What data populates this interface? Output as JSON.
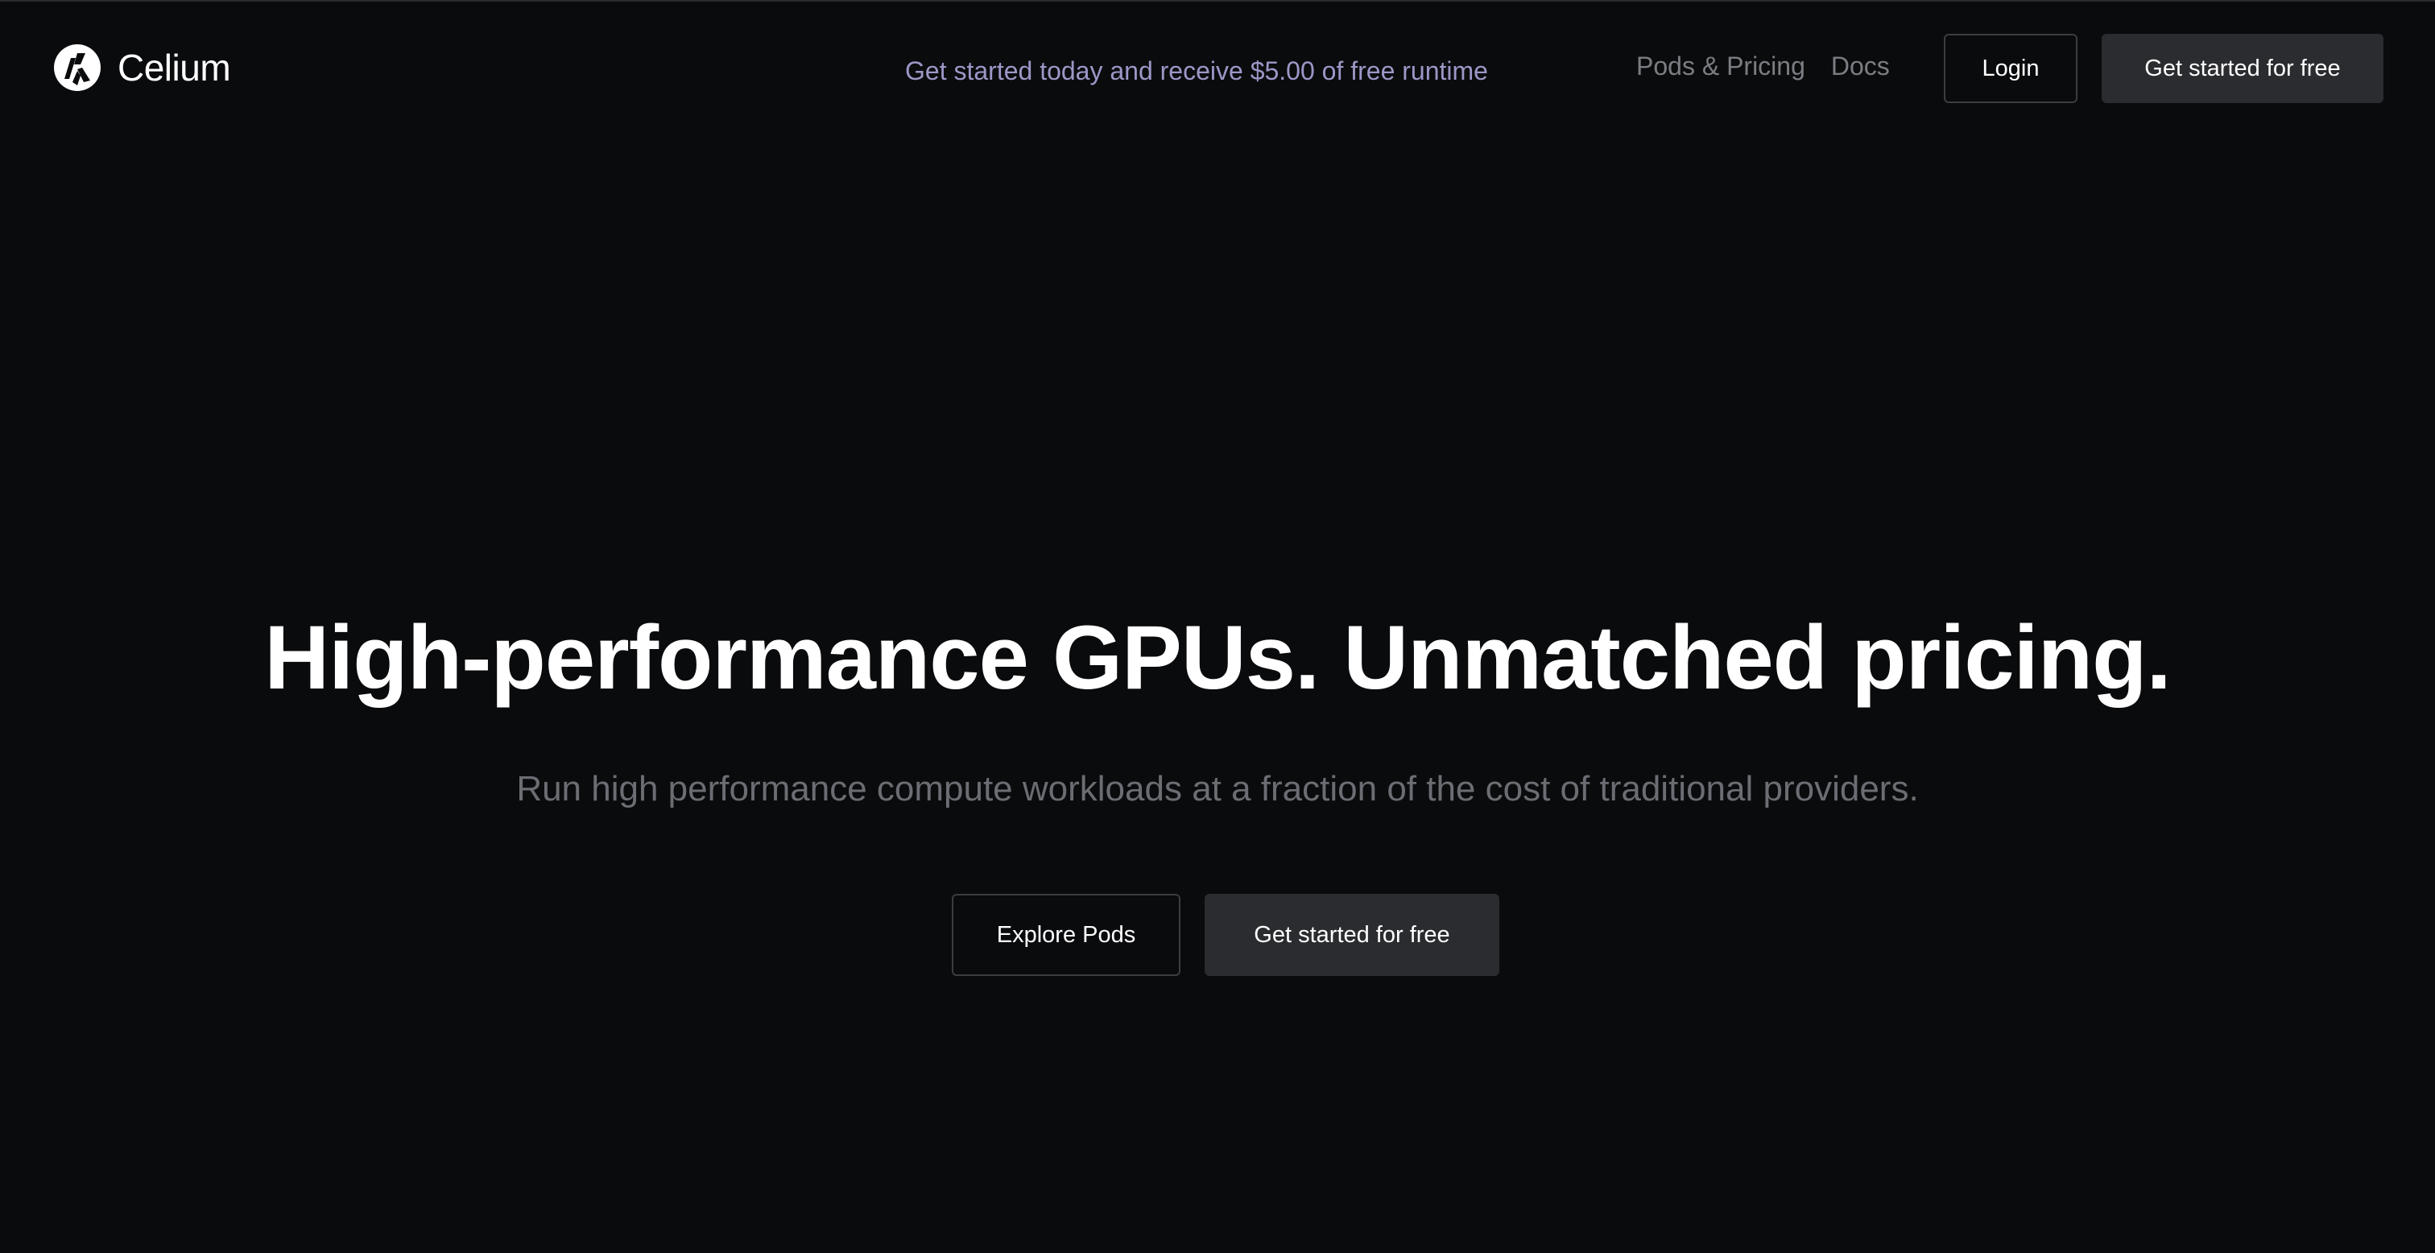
{
  "brand": {
    "name": "Celium",
    "logo_icon": "celium-logo-icon"
  },
  "header": {
    "promo_text": "Get started today and receive $5.00 of free runtime",
    "nav": [
      {
        "label": "Pods & Pricing"
      },
      {
        "label": "Docs"
      }
    ],
    "login_label": "Login",
    "cta_label": "Get started for free"
  },
  "hero": {
    "title": "High-performance GPUs. Unmatched pricing.",
    "subtitle": "Run high performance compute workloads at a fraction of the cost of traditional providers.",
    "primary_label": "Explore Pods",
    "secondary_label": "Get started for free"
  },
  "colors": {
    "background": "#0a0b0d",
    "promo": "#9c97c7",
    "nav_link": "#7c7d82",
    "subtitle": "#6c6d72",
    "button_filled": "#2b2c30",
    "button_border": "#3c3d42"
  }
}
